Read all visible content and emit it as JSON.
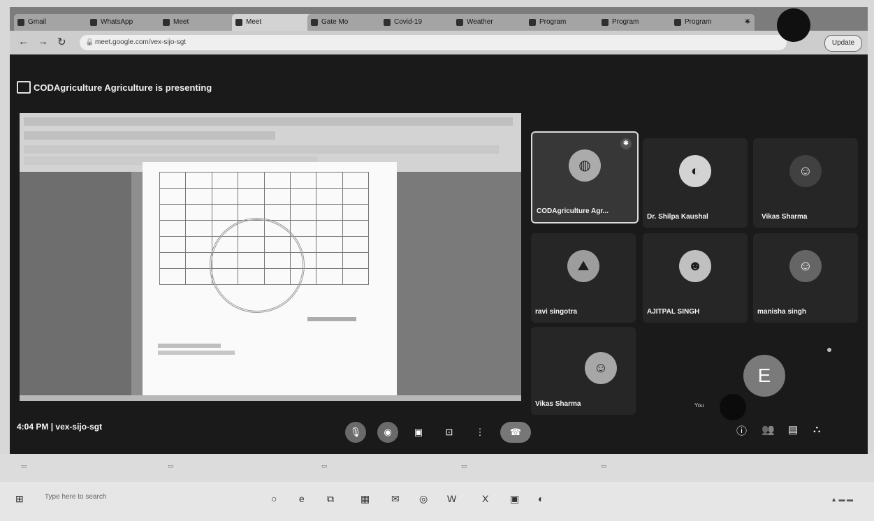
{
  "browser": {
    "tabs": [
      {
        "label": "Gmail"
      },
      {
        "label": "WhatsApp"
      },
      {
        "label": "Meet"
      },
      {
        "label": "Meet",
        "active": true
      },
      {
        "label": "Gate Mo"
      },
      {
        "label": "Covid-19"
      },
      {
        "label": "Weather"
      },
      {
        "label": "Program"
      },
      {
        "label": "Program"
      },
      {
        "label": "Program"
      }
    ],
    "url": "meet.google.com/vex-sijo-sgt",
    "update_label": "Update"
  },
  "meet": {
    "presenting_text": "CODAgriculture Agriculture is presenting",
    "meeting_time": "4:04 PM",
    "separator": "|",
    "meeting_code": "vex-sijo-sgt",
    "participants": [
      {
        "name": "CODAgriculture Agr...",
        "pinned": true
      },
      {
        "name": "Dr. Shilpa Kaushal"
      },
      {
        "name": "Vikas Sharma"
      },
      {
        "name": "ravi singotra"
      },
      {
        "name": "AJITPAL SINGH"
      },
      {
        "name": "manisha singh"
      },
      {
        "name": "Vikas Sharma"
      }
    ],
    "self_initial": "E",
    "self_label": "You"
  },
  "icons": {
    "mic": "mic-icon",
    "camera": "camera-icon",
    "captions": "captions-icon",
    "present": "present-icon",
    "more": "more-options-icon",
    "end_call": "end-call-icon",
    "info": "info-icon",
    "people": "people-icon",
    "chat": "chat-icon",
    "activities": "activities-icon"
  },
  "taskbar": {
    "search_placeholder": "Type here to search",
    "start_label": "Start"
  }
}
